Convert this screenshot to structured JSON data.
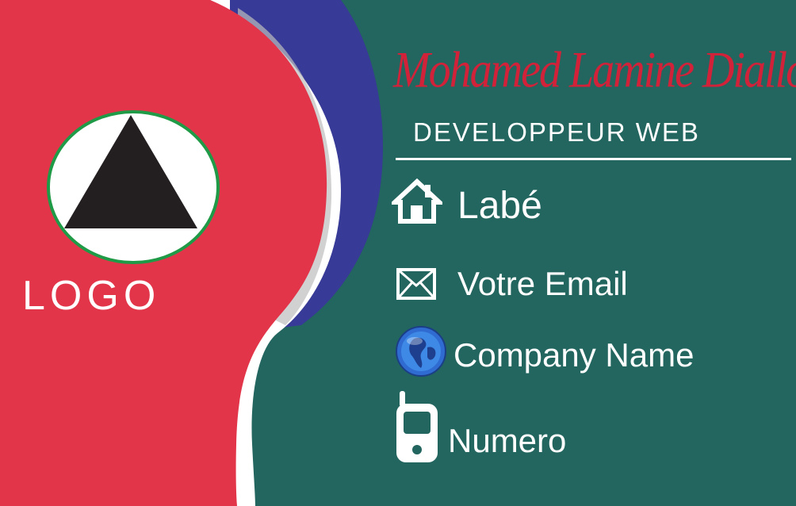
{
  "card": {
    "name": "Mohamed Lamine Diallo",
    "title": "DEVELOPPEUR WEB",
    "logo_label": "LOGO"
  },
  "contacts": {
    "city": "Labé",
    "email": "Votre Email",
    "company": "Company Name",
    "phone": "Numero"
  },
  "icons": [
    "home-icon",
    "mail-icon",
    "globe-icon",
    "phone-icon"
  ],
  "colors": {
    "red": "#e2354a",
    "blue": "#373a96",
    "teal": "#23655f",
    "white": "#ffffff",
    "logo_green": "#1f9a46",
    "triangle": "#231f20"
  }
}
